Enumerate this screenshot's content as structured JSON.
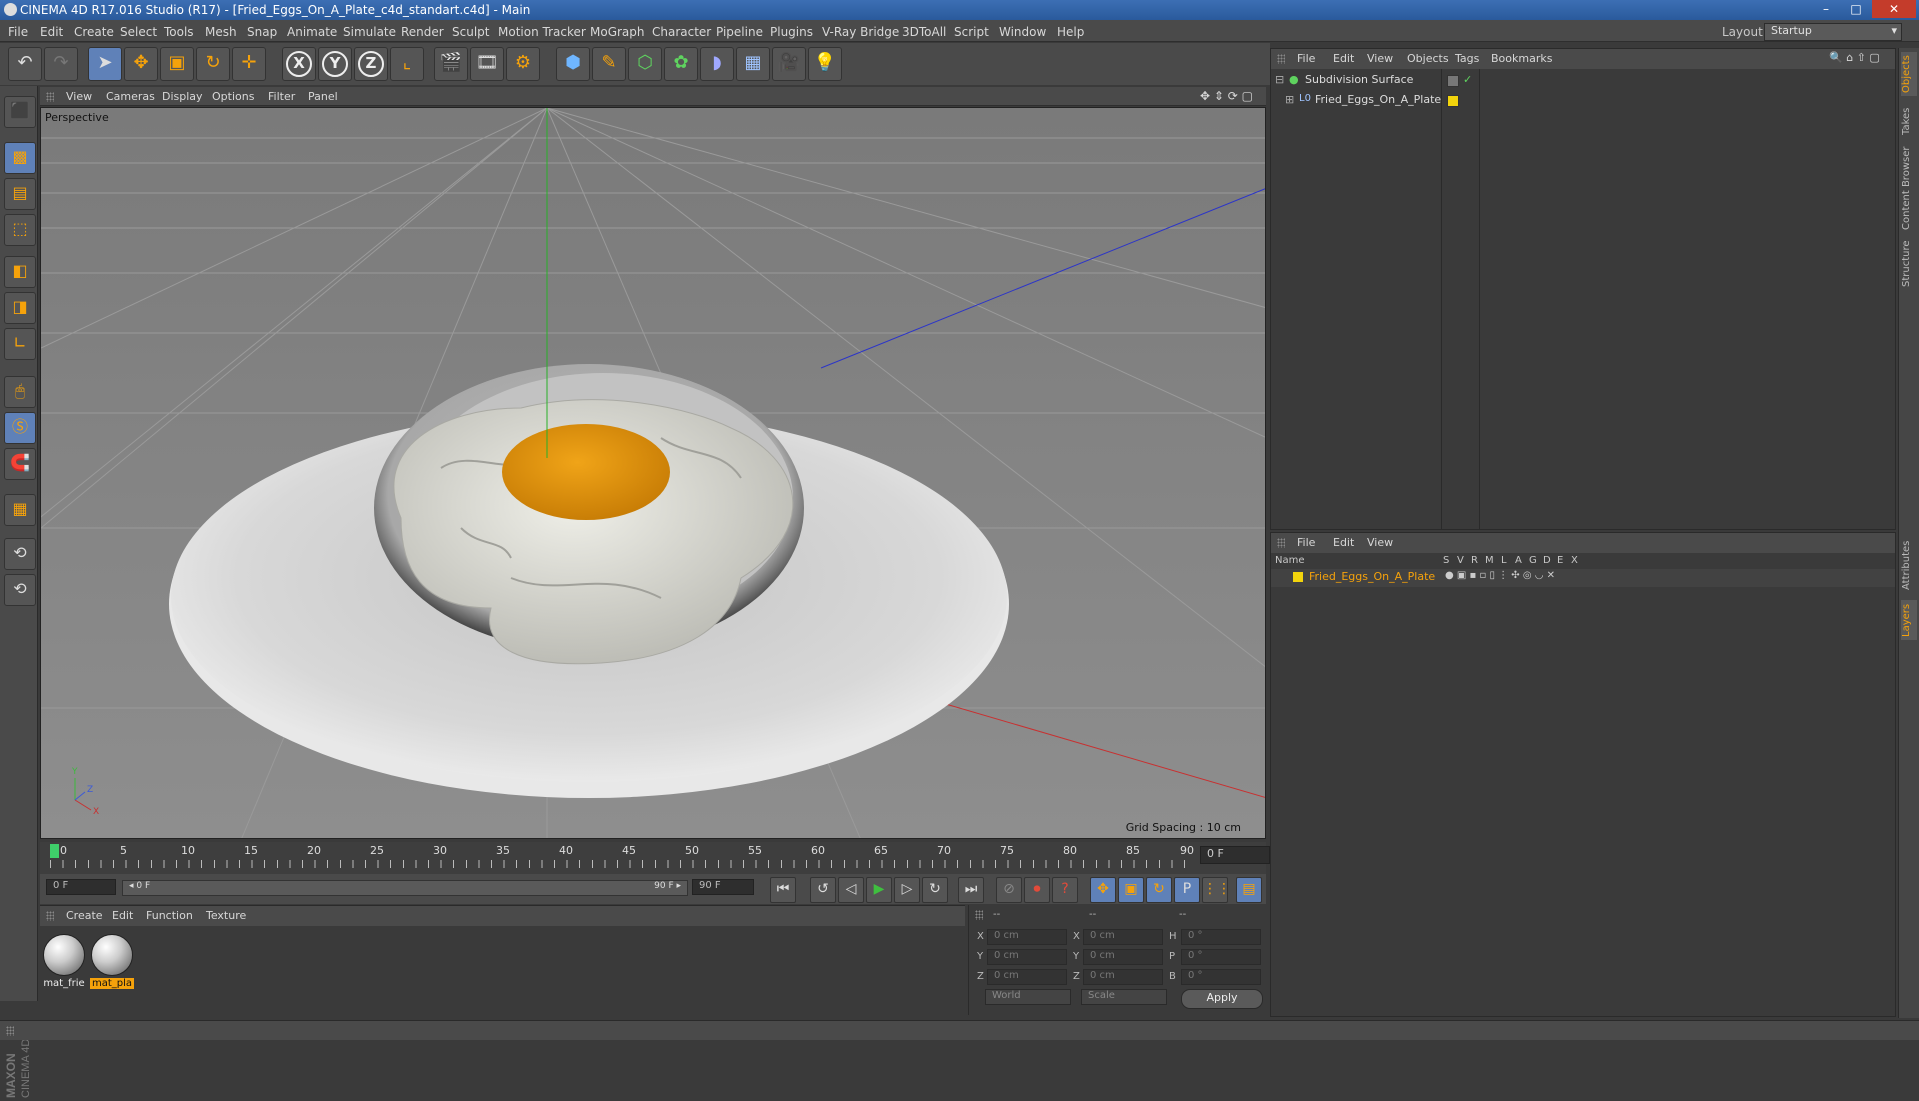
{
  "window": {
    "title": "CINEMA 4D R17.016 Studio (R17) - [Fried_Eggs_On_A_Plate_c4d_standart.c4d] - Main",
    "min": "–",
    "max": "□",
    "close": "✕"
  },
  "menu": [
    "File",
    "Edit",
    "Create",
    "Select",
    "Tools",
    "Mesh",
    "Snap",
    "Animate",
    "Simulate",
    "Render",
    "Sculpt",
    "Motion Tracker",
    "MoGraph",
    "Character",
    "Pipeline",
    "Plugins",
    "V-Ray Bridge",
    "3DToAll",
    "Script",
    "Window",
    "Help"
  ],
  "layout": {
    "label": "Layout:",
    "value": "Startup"
  },
  "toolbar": {
    "undo": "↶",
    "redo": "↷",
    "select": "➤",
    "move": "✥",
    "scale": "▣",
    "rotate": "↻",
    "move2": "✛",
    "x": "X",
    "y": "Y",
    "z": "Z",
    "coord": "⌞",
    "render_view": "🎬",
    "render_pv": "🎞",
    "render_settings": "⚙",
    "cube": "⬢",
    "pen": "✎",
    "nurbs": "⬡",
    "array": "✿",
    "deformer": "◗",
    "floor": "▦",
    "camera": "🎥",
    "light": "💡"
  },
  "lefttools": [
    "⬛",
    "▩",
    "▤",
    "⬚",
    "◧",
    "◨",
    "∟",
    "🖱",
    "Ⓢ",
    "🧲",
    "▦",
    "⟲"
  ],
  "maxon_logo": "MAXON CINEMA 4D",
  "viewport": {
    "menu": [
      "View",
      "Cameras",
      "Display",
      "Options",
      "Filter",
      "Panel"
    ],
    "label": "Perspective",
    "grid_spacing": "Grid Spacing : 10 cm",
    "nav": "✥ ⇕ ⟳ ▢"
  },
  "timeline": {
    "ticks": [
      "0",
      "5",
      "10",
      "15",
      "20",
      "25",
      "30",
      "35",
      "40",
      "45",
      "50",
      "55",
      "60",
      "65",
      "70",
      "75",
      "80",
      "85",
      "90"
    ],
    "current": "0 F",
    "start": "0 F",
    "range_start": "◂ 0 F",
    "range_end": "90 F ▸",
    "end": "90 F",
    "end2": "90 F"
  },
  "transport": {
    "first": "⏮",
    "prev_key": "↺",
    "prev": "◁",
    "play": "▶",
    "next": "▷",
    "next_key": "↻",
    "last": "⏭",
    "record_off": "⊘",
    "record": "⏺",
    "autokey": "?",
    "k_move": "✥",
    "k_scale": "▣",
    "k_rot": "↻",
    "k_param": "P",
    "k_pla": "⋮⋮",
    "timeline_btn": "▤"
  },
  "materials": {
    "menu": [
      "Create",
      "Edit",
      "Function",
      "Texture"
    ],
    "items": [
      {
        "label": "mat_frie",
        "selected": false
      },
      {
        "label": "mat_pla",
        "selected": true
      }
    ]
  },
  "coords": {
    "headers": [
      "--",
      "--",
      "--"
    ],
    "rows": [
      {
        "a": "X",
        "av": "0 cm",
        "b": "X",
        "bv": "0 cm",
        "c": "H",
        "cv": "0 °"
      },
      {
        "a": "Y",
        "av": "0 cm",
        "b": "Y",
        "bv": "0 cm",
        "c": "P",
        "cv": "0 °"
      },
      {
        "a": "Z",
        "av": "0 cm",
        "b": "Z",
        "bv": "0 cm",
        "c": "B",
        "cv": "0 °"
      }
    ],
    "mode": "World",
    "type": "Scale",
    "apply": "Apply"
  },
  "objmgr": {
    "menu": [
      "File",
      "Edit",
      "View",
      "Objects",
      "Tags",
      "Bookmarks"
    ],
    "objects": [
      {
        "name": "Subdivision Surface",
        "prefix": "⊟",
        "icon": "●",
        "check": "✓"
      },
      {
        "name": "Fried_Eggs_On_A_Plate",
        "prefix": "⊞",
        "icon": "L0",
        "check": ""
      }
    ],
    "tools": "🔍 ⌂ ⇧ ▢"
  },
  "layermgr": {
    "menu": [
      "File",
      "Edit",
      "View"
    ],
    "cols": [
      "Name",
      "S",
      "V",
      "R",
      "M",
      "L",
      "A",
      "G",
      "D",
      "E",
      "X"
    ],
    "layers": [
      {
        "name": "Fried_Eggs_On_A_Plate"
      }
    ]
  },
  "sidetabs": [
    "Objects",
    "Takes",
    "Content Browser",
    "Structure",
    "Attributes",
    "Layers"
  ],
  "colors": {
    "accent": "#f5a20b",
    "selection": "#5f81b8",
    "layer": "#f2d40c"
  }
}
